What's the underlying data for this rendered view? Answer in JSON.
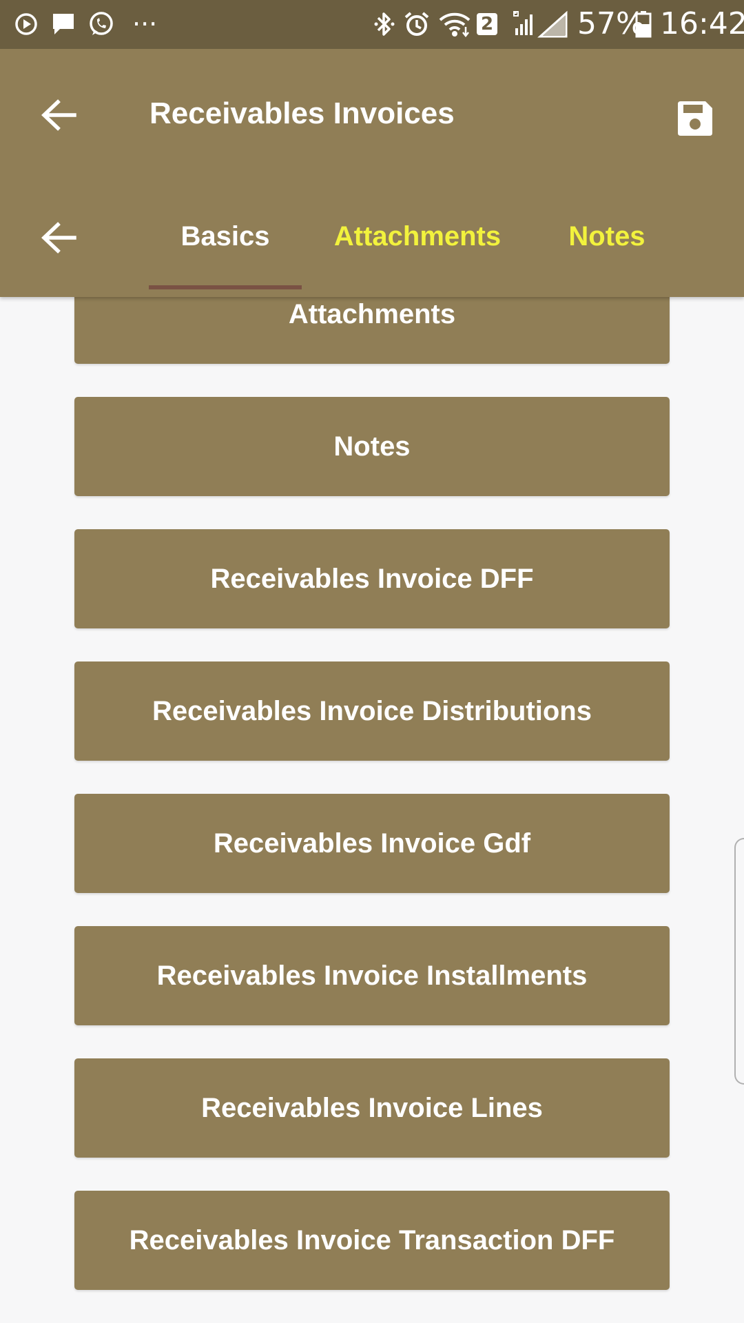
{
  "status_bar": {
    "battery": "57%",
    "time": "16:42",
    "sim_badge": "2",
    "dots": "···",
    "icons": [
      "media-play-icon",
      "message-icon",
      "whatsapp-icon",
      "more-dots-icon",
      "bluetooth-icon",
      "alarm-icon",
      "wifi-icon",
      "sim-badge-icon",
      "signal-icon",
      "battery-icon"
    ]
  },
  "toolbar": {
    "title": "Receivables Invoices",
    "back_icon": "arrow-back-icon",
    "save_icon": "save-icon"
  },
  "tabs": {
    "back_icon": "arrow-back-icon",
    "items": [
      {
        "label": "Basics",
        "active": true
      },
      {
        "label": "Attachments",
        "active": false
      },
      {
        "label": "Notes",
        "active": false
      }
    ]
  },
  "buttons": [
    "Attachments",
    "Notes",
    "Receivables Invoice DFF",
    "Receivables Invoice Distributions",
    "Receivables Invoice Gdf",
    "Receivables Invoice Installments",
    "Receivables Invoice Lines",
    "Receivables Invoice Transaction DFF"
  ],
  "colors": {
    "primary": "#907e56",
    "status_bar": "#6b5e40",
    "tab_active_text": "#ffffff",
    "tab_inactive_text": "#f2f23d",
    "tab_indicator": "#7a5244",
    "background": "#f7f7f8"
  }
}
